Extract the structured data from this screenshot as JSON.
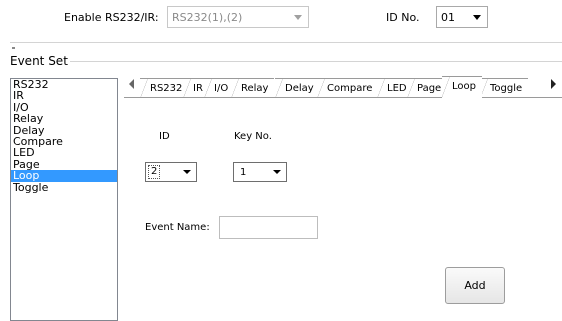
{
  "top": {
    "enable_label": "Enable RS232/IR:",
    "enable_value": "RS232(1),(2)",
    "id_label": "ID No.",
    "id_value": "01"
  },
  "event_set": {
    "title": "Event Set",
    "list": [
      "RS232",
      "IR",
      "I/O",
      "Relay",
      "Delay",
      "Compare",
      "LED",
      "Page",
      "Loop",
      "Toggle"
    ],
    "selected": "Loop"
  },
  "tabs": {
    "items": [
      "RS232",
      "IR",
      "I/O",
      "Relay",
      "Delay",
      "Compare",
      "LED",
      "Page",
      "Loop",
      "Toggle"
    ],
    "active": "Loop"
  },
  "loop_panel": {
    "id_label": "ID",
    "key_label": "Key No.",
    "id_value": "2",
    "key_value": "1",
    "event_name_label": "Event Name:",
    "event_name_value": "",
    "add_button": "Add"
  },
  "colors": {
    "selection": "#3399ff",
    "border": "#828790"
  },
  "icons": {
    "tab_scroll_left": "triangle-left-icon",
    "tab_scroll_right": "triangle-right-icon",
    "dropdown": "chevron-down-icon"
  }
}
